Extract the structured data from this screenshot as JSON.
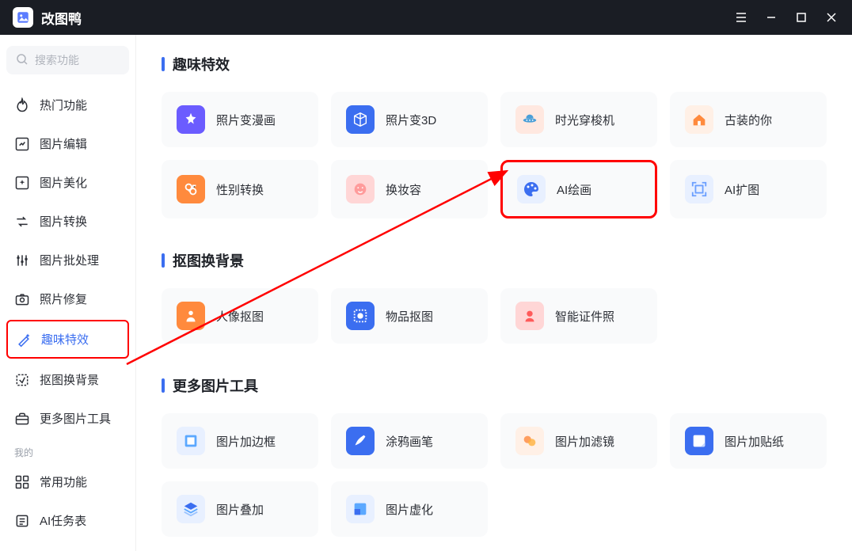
{
  "app": {
    "title": "改图鸭"
  },
  "sidebar": {
    "search_placeholder": "搜索功能",
    "items": [
      {
        "label": "热门功能"
      },
      {
        "label": "图片编辑"
      },
      {
        "label": "图片美化"
      },
      {
        "label": "图片转换"
      },
      {
        "label": "图片批处理"
      },
      {
        "label": "照片修复"
      },
      {
        "label": "趣味特效"
      },
      {
        "label": "抠图换背景"
      },
      {
        "label": "更多图片工具"
      }
    ],
    "my_section_label": "我的",
    "my_items": [
      {
        "label": "常用功能"
      },
      {
        "label": "AI任务表"
      }
    ]
  },
  "sections": [
    {
      "title": "趣味特效",
      "cards": [
        {
          "label": "照片变漫画"
        },
        {
          "label": "照片变3D"
        },
        {
          "label": "时光穿梭机"
        },
        {
          "label": "古装的你"
        },
        {
          "label": "性别转换"
        },
        {
          "label": "换妆容"
        },
        {
          "label": "AI绘画"
        },
        {
          "label": "AI扩图"
        }
      ]
    },
    {
      "title": "抠图换背景",
      "cards": [
        {
          "label": "人像抠图"
        },
        {
          "label": "物品抠图"
        },
        {
          "label": "智能证件照"
        }
      ]
    },
    {
      "title": "更多图片工具",
      "cards": [
        {
          "label": "图片加边框"
        },
        {
          "label": "涂鸦画笔"
        },
        {
          "label": "图片加滤镜"
        },
        {
          "label": "图片加贴纸"
        },
        {
          "label": "图片叠加"
        },
        {
          "label": "图片虚化"
        }
      ]
    }
  ]
}
